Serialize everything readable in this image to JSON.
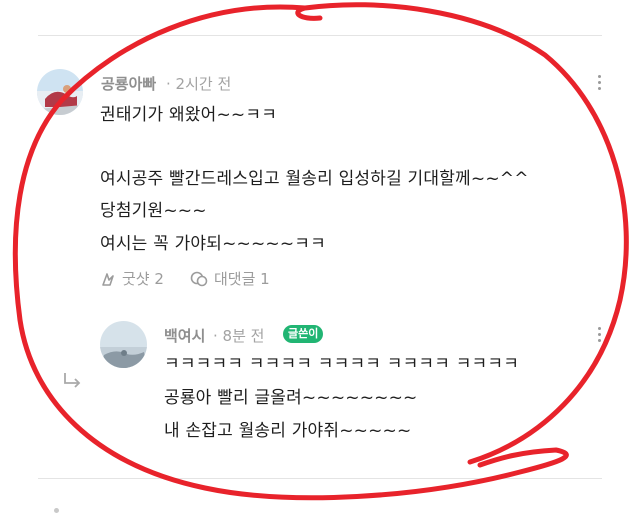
{
  "comment": {
    "author": "공룡아빠",
    "time": "· 2시간 전",
    "lines": [
      "권태기가 왜왔어~~ㅋㅋ",
      "",
      "여시공주 빨간드레스입고 월송리 입성하길 기대할께~~^^",
      "당첨기원~~~",
      "여시는 꼭 가야되~~~~~ㅋㅋ"
    ],
    "actions": {
      "like_label": "굿샷 2",
      "reply_label": "대댓글 1"
    }
  },
  "reply": {
    "author": "백여시",
    "time": "· 8분 전",
    "badge": "글쓴이",
    "lines": [
      "ㅋㅋㅋㅋㅋ ㅋㅋㅋㅋ ㅋㅋㅋㅋ ㅋㅋㅋㅋ ㅋㅋㅋㅋ",
      "공룡아 빨리 글올려~~~~~~~~",
      "내 손잡고 월송리 가야쥐~~~~~"
    ]
  },
  "icons": {
    "more": "more-vertical-icon",
    "like": "golf-shot-icon",
    "reply": "comment-bubble-icon",
    "reply_indent": "reply-arrow-icon"
  },
  "colors": {
    "annotation": "#e8232b",
    "badge": "#21b573"
  }
}
